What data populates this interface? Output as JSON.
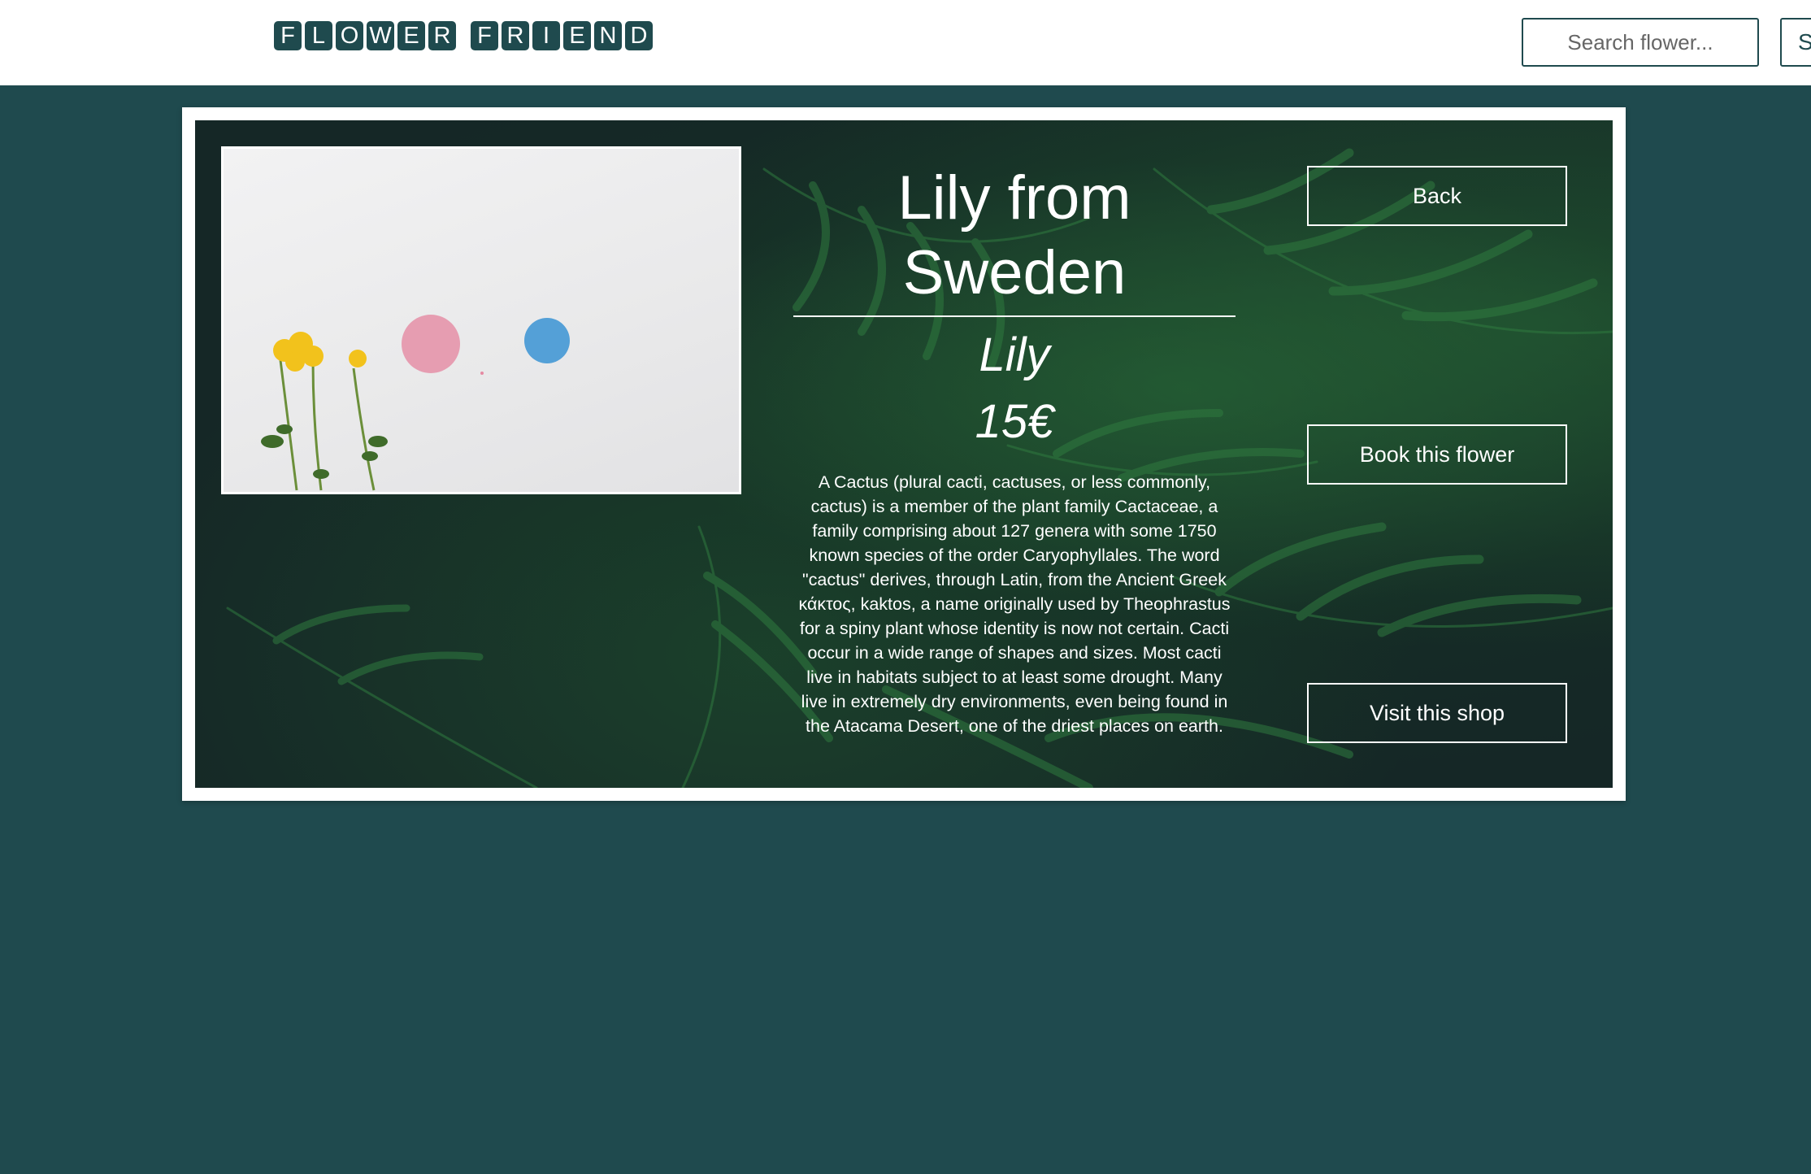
{
  "header": {
    "logo_words": [
      [
        "F",
        "L",
        "O",
        "W",
        "E",
        "R"
      ],
      [
        "F",
        "R",
        "I",
        "E",
        "N",
        "D"
      ]
    ],
    "search_placeholder": "Search flower...",
    "search_button_label": "S"
  },
  "flower": {
    "title": "Lily from Sweden",
    "species": "Lily",
    "price": "15€",
    "description": "A Cactus (plural cacti, cactuses, or less commonly, cactus) is a member of the plant family Cactaceae, a family comprising about 127 genera with some 1750 known species of the order Caryophyllales. The word \"cactus\" derives, through Latin, from the Ancient Greek κάκτος, kaktos, a name originally used by Theophrastus for a spiny plant whose identity is now not certain. Cacti occur in a wide range of shapes and sizes. Most cacti live in habitats subject to at least some drought. Many live in extremely dry environments, even being found in the Atacama Desert, one of the driest places on earth."
  },
  "actions": {
    "back_label": "Back",
    "book_label": "Book this flower",
    "visit_label": "Visit this shop"
  },
  "colors": {
    "brand": "#1f4a4e",
    "card_dark": "#152726",
    "text_light": "#ffffff"
  }
}
